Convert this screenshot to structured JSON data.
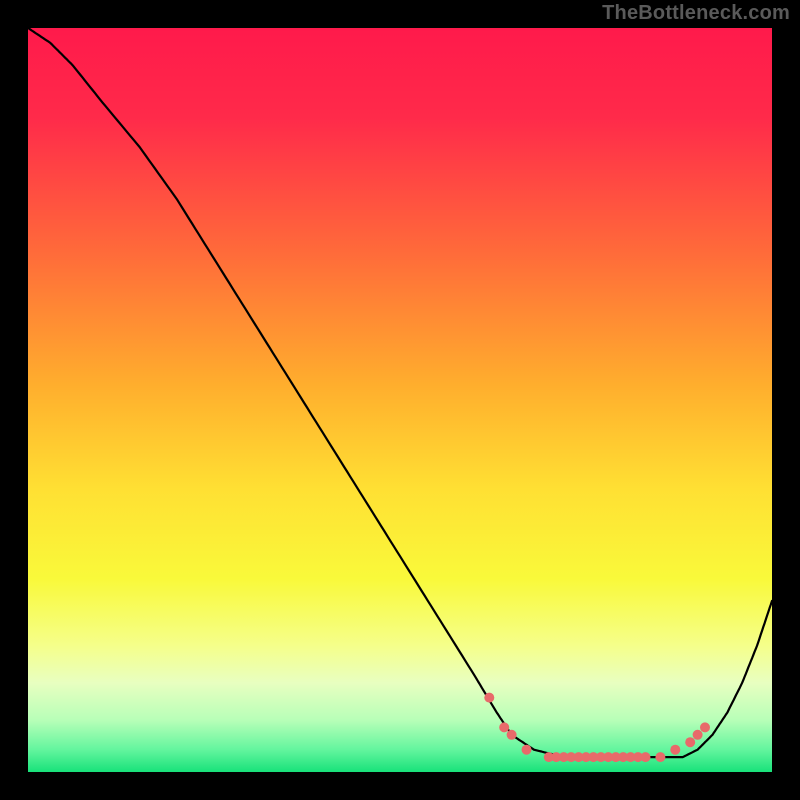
{
  "watermark": "TheBottleneck.com",
  "chart_data": {
    "type": "line",
    "title": "",
    "xlabel": "",
    "ylabel": "",
    "xlim": [
      0,
      100
    ],
    "ylim": [
      0,
      100
    ],
    "gradient_stops": [
      {
        "offset": 0,
        "color": "#ff1a4b"
      },
      {
        "offset": 12,
        "color": "#ff2a4a"
      },
      {
        "offset": 30,
        "color": "#ff6a3a"
      },
      {
        "offset": 48,
        "color": "#ffae2d"
      },
      {
        "offset": 62,
        "color": "#ffe033"
      },
      {
        "offset": 74,
        "color": "#f9f93a"
      },
      {
        "offset": 83,
        "color": "#f5ff8a"
      },
      {
        "offset": 88,
        "color": "#e8ffc0"
      },
      {
        "offset": 93,
        "color": "#b8ffb8"
      },
      {
        "offset": 97,
        "color": "#63f59e"
      },
      {
        "offset": 100,
        "color": "#18e27a"
      }
    ],
    "series": [
      {
        "name": "curve",
        "x": [
          0,
          3,
          6,
          10,
          15,
          20,
          25,
          30,
          35,
          40,
          45,
          50,
          55,
          60,
          63,
          65,
          68,
          72,
          76,
          80,
          84,
          88,
          90,
          92,
          94,
          96,
          98,
          100
        ],
        "y": [
          100,
          98,
          95,
          90,
          84,
          77,
          69,
          61,
          53,
          45,
          37,
          29,
          21,
          13,
          8,
          5,
          3,
          2,
          2,
          2,
          2,
          2,
          3,
          5,
          8,
          12,
          17,
          23
        ]
      }
    ],
    "markers": {
      "name": "highlighted-points",
      "x": [
        62,
        64,
        65,
        67,
        70,
        71,
        72,
        73,
        74,
        75,
        76,
        77,
        78,
        79,
        80,
        81,
        82,
        83,
        85,
        87,
        89,
        90,
        91
      ],
      "y": [
        10,
        6,
        5,
        3,
        2,
        2,
        2,
        2,
        2,
        2,
        2,
        2,
        2,
        2,
        2,
        2,
        2,
        2,
        2,
        3,
        4,
        5,
        6
      ],
      "color": "#e86a6a",
      "radius": 5
    }
  }
}
